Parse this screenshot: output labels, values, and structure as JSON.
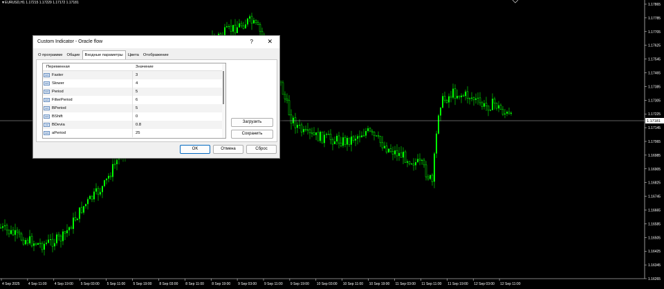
{
  "chart": {
    "symbol_header": "EURUSD,H1  1.17215 1.17229 1.17172 1.17181",
    "current_price": "1.17181",
    "price_levels": [
      "1.17865",
      "1.17785",
      "1.17705",
      "1.17625",
      "1.17545",
      "1.17465",
      "1.17385",
      "1.17305",
      "1.17225",
      "1.17145",
      "1.17065",
      "1.16985",
      "1.16905",
      "1.16825",
      "1.16745",
      "1.16665",
      "1.16585",
      "1.16505",
      "1.16425",
      "1.16345",
      "1.16265"
    ],
    "time_labels": [
      "4 Sep 2025",
      "4 Sep 11:00",
      "4 Sep 19:00",
      "5 Sep 03:00",
      "5 Sep 11:00",
      "5 Sep 19:00",
      "8 Sep 03:00",
      "8 Sep 11:00",
      "8 Sep 19:00",
      "9 Sep 03:00",
      "9 Sep 11:00",
      "9 Sep 19:00",
      "10 Sep 03:00",
      "10 Sep 11:00",
      "10 Sep 19:00",
      "11 Sep 03:00",
      "11 Sep 11:00",
      "11 Sep 19:00",
      "12 Sep 03:00",
      "12 Sep 11:00"
    ],
    "colors": {
      "background": "#000000",
      "candles": "#00ff00",
      "price_line": "#c0c0c0",
      "axis_text": "#ffffff"
    }
  },
  "dialog": {
    "title": "Custom Indicator - Oracle flow",
    "help_glyph": "?",
    "close_glyph": "✕",
    "tabs": [
      {
        "label": "О программе",
        "active": false
      },
      {
        "label": "Общие",
        "active": false
      },
      {
        "label": "Входные параметры",
        "active": true
      },
      {
        "label": "Цвета",
        "active": false
      },
      {
        "label": "Отображение",
        "active": false
      }
    ],
    "columns": {
      "variable": "Переменная",
      "value": "Значение"
    },
    "params": [
      {
        "type": "123",
        "name": "Faster",
        "value": "3"
      },
      {
        "type": "123",
        "name": "Slower",
        "value": "4"
      },
      {
        "type": "123",
        "name": "Period",
        "value": "5"
      },
      {
        "type": "123",
        "name": "FilterPeriod",
        "value": "6"
      },
      {
        "type": "123",
        "name": "BPeriod",
        "value": "5"
      },
      {
        "type": "123",
        "name": "BShift",
        "value": "0"
      },
      {
        "type": "1/2",
        "name": "BDevia",
        "value": "0.8"
      },
      {
        "type": "123",
        "name": "aPeriod",
        "value": "25"
      }
    ],
    "buttons": {
      "load": "Загрузить",
      "save": "Сохранить",
      "ok": "OK",
      "cancel": "Отмена",
      "reset": "Сброс"
    }
  }
}
